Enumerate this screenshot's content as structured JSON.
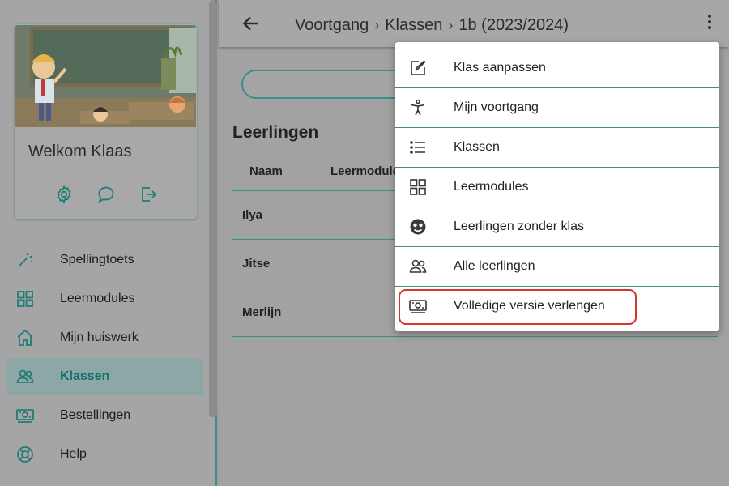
{
  "colors": {
    "accent": "#3a8f8a",
    "highlight": "#d9342b",
    "overlay": "#9e9e9e"
  },
  "sidebar": {
    "profile": {
      "welcome": "Welkom Klaas",
      "actions": [
        {
          "icon": "gear-icon"
        },
        {
          "icon": "chat-bubble-icon"
        },
        {
          "icon": "logout-icon"
        }
      ]
    },
    "items": [
      {
        "label": "Spellingtoets",
        "icon": "magic-wand-icon"
      },
      {
        "label": "Leermodules",
        "icon": "grid-icon"
      },
      {
        "label": "Mijn huiswerk",
        "icon": "home-icon"
      },
      {
        "label": "Klassen",
        "icon": "people-icon",
        "active": true
      },
      {
        "label": "Bestellingen",
        "icon": "banknote-icon"
      },
      {
        "label": "Help",
        "icon": "lifebuoy-icon"
      }
    ]
  },
  "header": {
    "breadcrumb": [
      "Voortgang",
      "Klassen",
      "1b (2023/2024)"
    ]
  },
  "main": {
    "section_title": "Leerlingen",
    "columns": [
      "Naam",
      "Leermodule"
    ],
    "rows": [
      "Ilya",
      "Jitse",
      "Merlijn"
    ]
  },
  "menu": {
    "items": [
      {
        "label": "Klas aanpassen",
        "icon": "edit-icon"
      },
      {
        "label": "Mijn voortgang",
        "icon": "accessibility-icon"
      },
      {
        "label": "Klassen",
        "icon": "list-icon"
      },
      {
        "label": "Leermodules",
        "icon": "grid-icon"
      },
      {
        "label": "Leerlingen zonder klas",
        "icon": "face-icon"
      },
      {
        "label": "Alle leerlingen",
        "icon": "people-icon"
      },
      {
        "label": "Volledige versie verlengen",
        "icon": "banknote-icon",
        "highlighted": true
      }
    ]
  }
}
